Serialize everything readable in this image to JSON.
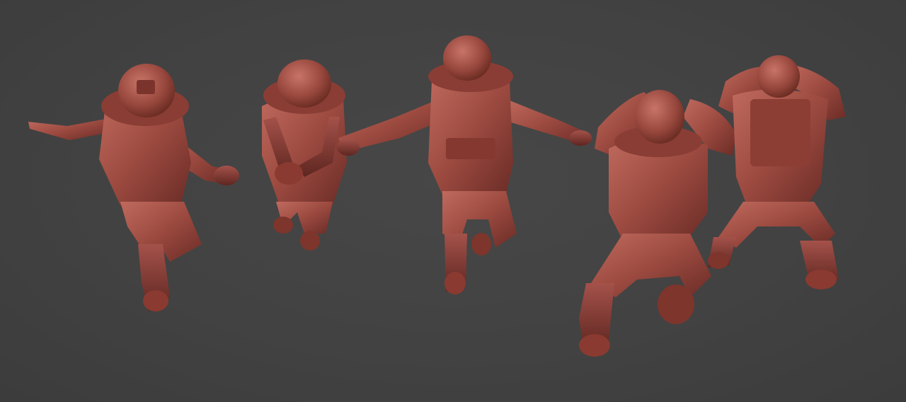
{
  "scene": {
    "background_color": "#414141",
    "material_color": "#9a4a40",
    "figure_count": 5,
    "figures": [
      {
        "pose": "arms-outstretched"
      },
      {
        "pose": "hands-clasped"
      },
      {
        "pose": "t-pose"
      },
      {
        "pose": "hands-on-head-front"
      },
      {
        "pose": "hands-on-head-back"
      }
    ]
  }
}
